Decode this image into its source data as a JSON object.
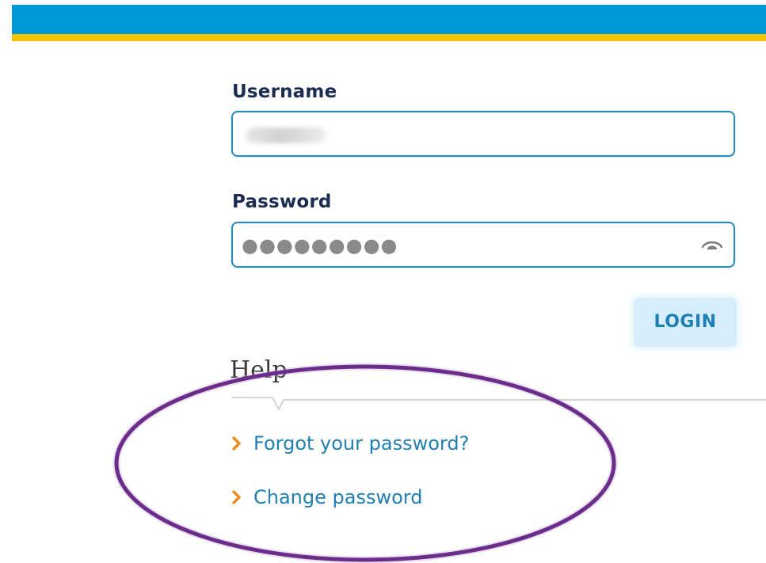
{
  "form": {
    "username_label": "Username",
    "username_value": "",
    "password_label": "Password",
    "password_masked": "●●●●●●●●●",
    "login_label": "LOGIN"
  },
  "help": {
    "title": "Help",
    "links": [
      {
        "label": "Forgot your password?"
      },
      {
        "label": "Change password"
      }
    ]
  },
  "icons": {
    "password_toggle": "eye-icon",
    "link_bullet": "chevron-right-icon"
  },
  "colors": {
    "header_blue": "#0099d8",
    "header_yellow": "#f5c400",
    "label_navy": "#1a2c52",
    "input_border": "#2a8ab9",
    "link_blue": "#1f7fb2",
    "chevron_orange": "#f08a1c",
    "login_bg": "#d6eefb",
    "annotation_purple": "#6b2c8c"
  }
}
